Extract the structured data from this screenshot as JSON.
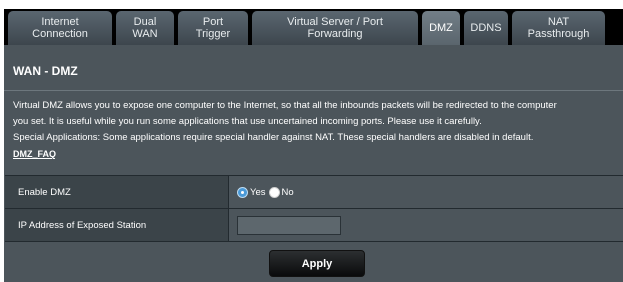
{
  "tabs": [
    {
      "label": "Internet\nConnection",
      "active": false
    },
    {
      "label": "Dual\nWAN",
      "active": false
    },
    {
      "label": "Port\nTrigger",
      "active": false
    },
    {
      "label": "Virtual Server / Port\nForwarding",
      "active": false
    },
    {
      "label": "DMZ",
      "active": true
    },
    {
      "label": "DDNS",
      "active": false
    },
    {
      "label": "NAT\nPassthrough",
      "active": false
    }
  ],
  "page": {
    "title": "WAN - DMZ",
    "description_lines": [
      "Virtual DMZ allows you to expose one computer to the Internet, so that all the inbounds packets will be redirected to the computer",
      "you set. It is useful while you run some applications that use uncertained incoming ports. Please use it carefully.",
      "Special Applications: Some applications require special handler against NAT. These special handlers are disabled in default."
    ],
    "faq_link": "DMZ_FAQ"
  },
  "settings": {
    "enable_dmz": {
      "label": "Enable DMZ",
      "options": [
        "Yes",
        "No"
      ],
      "selected": "Yes"
    },
    "exposed_station": {
      "label": "IP Address of Exposed Station",
      "value": ""
    }
  },
  "apply_label": "Apply",
  "colors": {
    "panel_bg": "#4c555b",
    "label_bg": "#3b4449",
    "tab_bg": "#4a545b",
    "radio_selected": "#4a9ad8"
  }
}
